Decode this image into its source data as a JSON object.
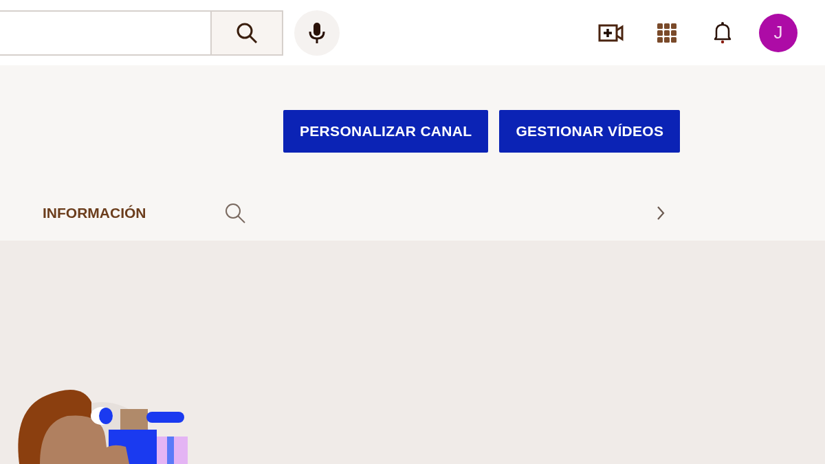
{
  "header": {
    "avatar_letter": "J"
  },
  "channel_actions": [
    "PERSONALIZAR CANAL",
    "GESTIONAR VÍDEOS"
  ],
  "tabs": [
    {
      "label": "INFORMACIÓN"
    }
  ]
}
